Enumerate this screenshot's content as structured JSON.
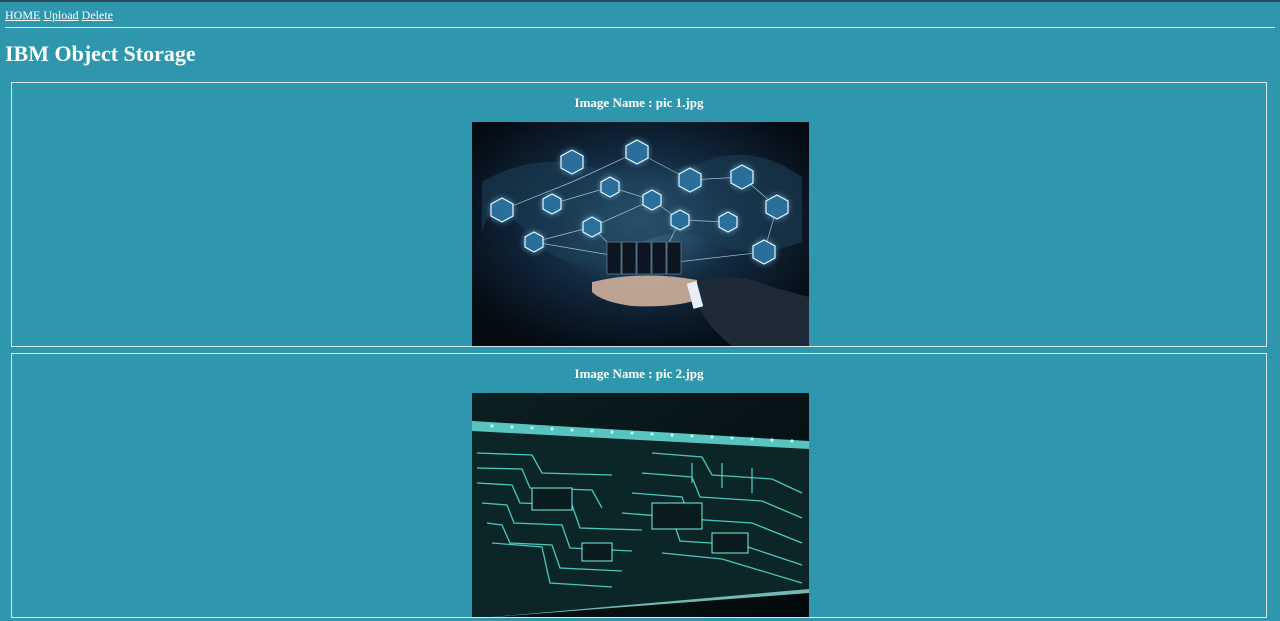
{
  "nav": {
    "links": [
      "HOME",
      "Upload",
      "Delete"
    ]
  },
  "page": {
    "title": "IBM Object Storage"
  },
  "images": [
    {
      "label_prefix": "Image Name : ",
      "name": "pic 1.jpg",
      "caption": "Image Name : pic 1.jpg",
      "subject": "cloud-network-hand-illustration"
    },
    {
      "label_prefix": "Image Name : ",
      "name": "pic 2.jpg",
      "caption": "Image Name : pic 2.jpg",
      "subject": "circuit-board-illustration"
    }
  ],
  "colors": {
    "background": "#2e97ad",
    "text": "#ffffff",
    "border": "#cfe9ef"
  }
}
